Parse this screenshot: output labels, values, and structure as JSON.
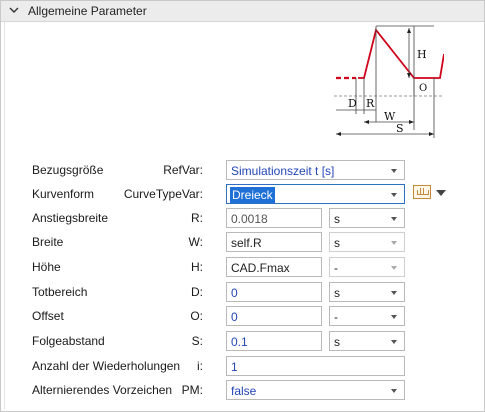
{
  "panel": {
    "title": "Allgemeine Parameter"
  },
  "diagram": {
    "labels": {
      "h": "H",
      "o": "O",
      "d": "D",
      "r": "R",
      "w": "W",
      "s": "S"
    }
  },
  "params": [
    {
      "label": "Bezugsgröße",
      "var": "RefVar:",
      "value": "Simulationszeit t [s]"
    },
    {
      "label": "Kurvenform",
      "var": "CurveTypeVar:",
      "value": "Dreieck"
    },
    {
      "label": "Anstiegsbreite",
      "var": "R:",
      "value": "0.0018",
      "unit": "s"
    },
    {
      "label": "Breite",
      "var": "W:",
      "value": "self.R",
      "unit": "s"
    },
    {
      "label": "Höhe",
      "var": "H:",
      "value": "CAD.Fmax",
      "unit": "-"
    },
    {
      "label": "Totbereich",
      "var": "D:",
      "value": "0",
      "unit": "s"
    },
    {
      "label": "Offset",
      "var": "O:",
      "value": "0",
      "unit": "-"
    },
    {
      "label": "Folgeabstand",
      "var": "S:",
      "value": "0.1",
      "unit": "s"
    },
    {
      "label": "Anzahl der Wiederholungen",
      "var": "i:",
      "value": "1"
    },
    {
      "label": "Alternierendes Vorzeichen",
      "var": "PM:",
      "value": "false"
    }
  ],
  "colors": {
    "accent": "#1e6fd6",
    "curve": "#d0021b",
    "value_blue": "#2346b8"
  }
}
